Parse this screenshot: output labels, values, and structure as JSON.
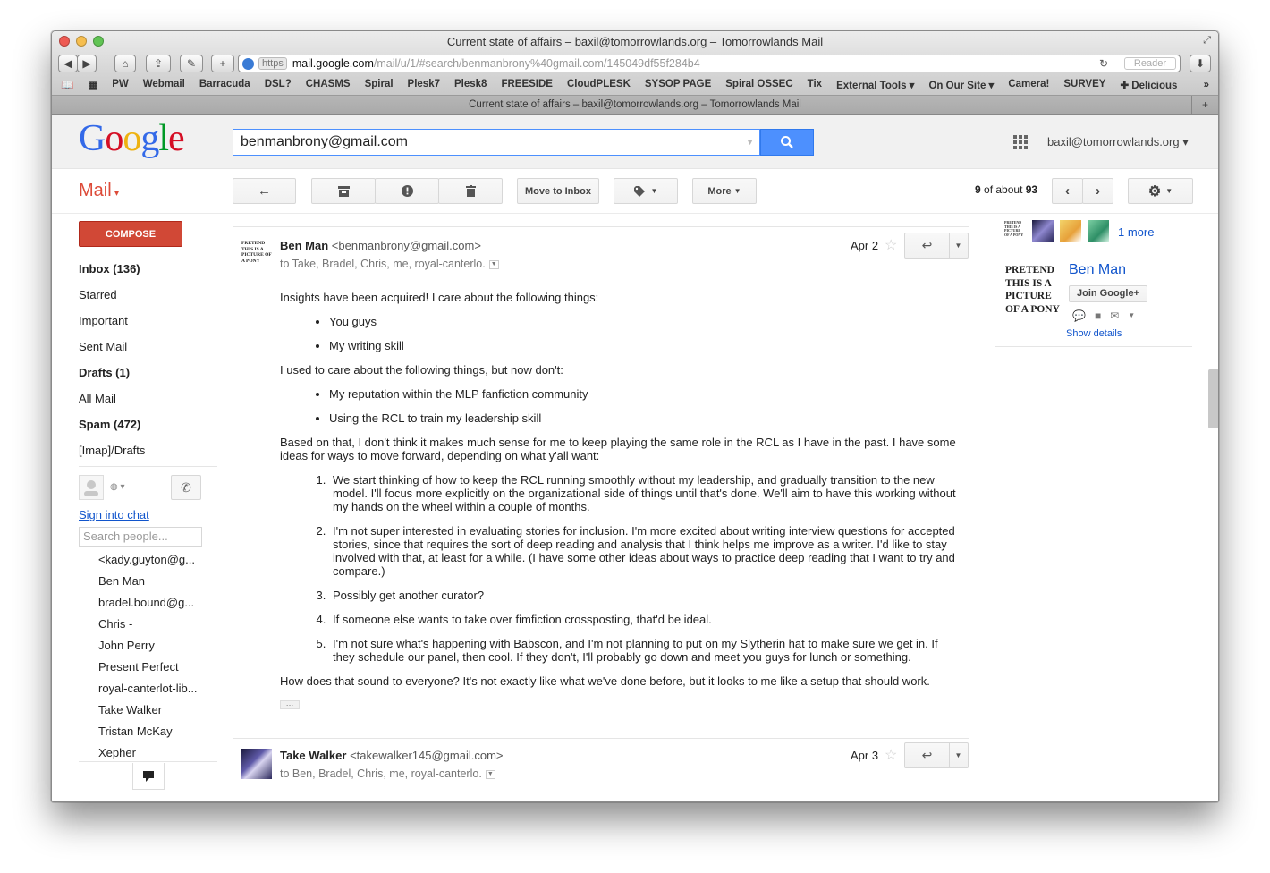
{
  "window": {
    "title": "Current state of affairs – baxil@tomorrowlands.org – Tomorrowlands Mail",
    "tab_title": "Current state of affairs – baxil@tomorrowlands.org – Tomorrowlands Mail"
  },
  "browser": {
    "url_scheme": "https",
    "url_host": "mail.google.com",
    "url_path": "/mail/u/1/#search/benmanbrony%40gmail.com/145049df55f284b4",
    "reader_label": "Reader",
    "bookmarks": [
      "PW",
      "Webmail",
      "Barracuda",
      "DSL?",
      "CHASMS",
      "Spiral",
      "Plesk7",
      "Plesk8",
      "FREESIDE",
      "CloudPLESK",
      "SYSOP PAGE",
      "Spiral OSSEC",
      "Tix",
      "External Tools ▾",
      "On Our Site ▾",
      "Camera!",
      "SURVEY",
      "✚ Delicious"
    ]
  },
  "gmail": {
    "search_value": "benmanbrony@gmail.com",
    "account": "baxil@tomorrowlands.org",
    "mail_label": "Mail",
    "move_to_inbox": "Move to Inbox",
    "more_label": "More",
    "pager_current": "9",
    "pager_of": "of about",
    "pager_total": "93",
    "compose": "COMPOSE"
  },
  "nav": {
    "items": [
      {
        "label": "Inbox (136)",
        "bold": true
      },
      {
        "label": "Starred",
        "bold": false
      },
      {
        "label": "Important",
        "bold": false
      },
      {
        "label": "Sent Mail",
        "bold": false
      },
      {
        "label": "Drafts (1)",
        "bold": true
      },
      {
        "label": "All Mail",
        "bold": false
      },
      {
        "label": "Spam (472)",
        "bold": true
      },
      {
        "label": "[Imap]/Drafts",
        "bold": false
      }
    ]
  },
  "chat": {
    "sign_in": "Sign into chat",
    "search_placeholder": "Search people...",
    "contacts": [
      "<kady.guyton@g...",
      "Ben Man",
      "bradel.bound@g...",
      "Chris -",
      "John Perry",
      "Present Perfect",
      "royal-canterlot-lib...",
      "Take Walker",
      "Tristan McKay",
      "Xepher"
    ]
  },
  "message1": {
    "pic_text": "PRETEND THIS IS A PICTURE OF A PONY",
    "sender_name": "Ben Man",
    "sender_email": "<benmanbrony@gmail.com>",
    "recipients": "to Take, Bradel, Chris, me, royal-canterlo.",
    "date": "Apr 2",
    "p1": "Insights have been acquired! I care about the following things:",
    "ul1": [
      "You guys",
      "My writing skill"
    ],
    "p2": "I used to care about the following things, but now don't:",
    "ul2": [
      "My reputation within the MLP fanfiction community",
      "Using the RCL to train my leadership skill"
    ],
    "p3": "Based on that, I don't think it makes much sense for me to keep playing the same role in the RCL as I have in the past. I have some ideas for ways to move forward, depending on what y'all want:",
    "ol": [
      "We start thinking of how to keep the RCL running smoothly without my leadership, and gradually transition to the new model. I'll focus more explicitly on the organizational side of things until that's done. We'll aim to have this working without my hands on the wheel within a couple of months.",
      "I'm not super interested in evaluating stories for inclusion. I'm more excited about writing interview questions for accepted stories, since that requires the sort of deep reading and analysis that I think helps me improve as a writer. I'd like to stay involved with that, at least for a while. (I have some other ideas about ways to practice deep reading that I want to try and compare.)",
      "Possibly get another curator?",
      "If someone else wants to take over fimfiction crossposting, that'd be ideal.",
      "I'm not sure what's happening with Babscon, and I'm not planning to put on my Slytherin hat to make sure we get in. If they schedule our panel, then cool. If they don't, I'll probably go down and meet you guys for lunch or something."
    ],
    "p4": "How does that sound to everyone? It's not exactly like what we've done before, but it looks to me like a setup that should work."
  },
  "message2": {
    "sender_name": "Take Walker",
    "sender_email": "<takewalker145@gmail.com>",
    "recipients": "to Ben, Bradel, Chris, me, royal-canterlo.",
    "date": "Apr 3"
  },
  "rightpane": {
    "small_pic_text": "PRETEND THIS IS A PICTURE OF A PONY",
    "more_link": "1 more",
    "big_pic_text": "PRETEND THIS IS A PICTURE OF A PONY",
    "name": "Ben Man",
    "join_button": "Join Google+",
    "show_details": "Show details"
  }
}
